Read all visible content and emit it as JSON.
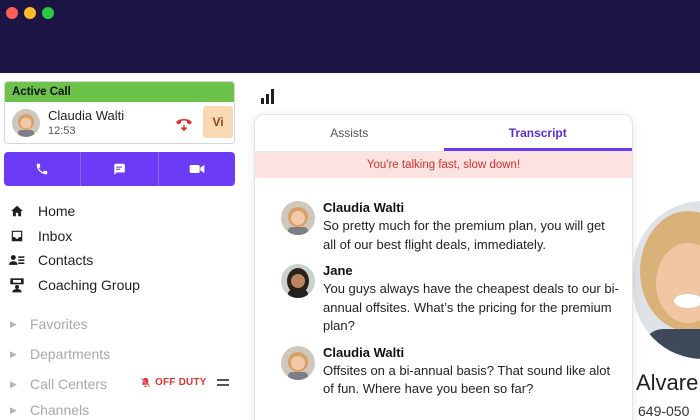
{
  "active_call": {
    "header": "Active Call",
    "caller_name": "Claudia Walti",
    "duration": "12:53",
    "vi_label": "Vi"
  },
  "nav": {
    "items": [
      {
        "label": "Home",
        "icon": "home-icon"
      },
      {
        "label": "Inbox",
        "icon": "inbox-icon"
      },
      {
        "label": "Contacts",
        "icon": "contacts-icon"
      },
      {
        "label": "Coaching Group",
        "icon": "coaching-group-icon"
      }
    ]
  },
  "sections": {
    "favorites": "Favorites",
    "departments": "Departments",
    "call_centers": "Call Centers",
    "call_centers_status": "OFF DUTY",
    "channels": "Channels"
  },
  "transcript_panel": {
    "tabs": [
      "Assists",
      "Transcript"
    ],
    "active_tab": "Transcript",
    "warning": "You're talking fast, slow down!",
    "messages": [
      {
        "speaker": "Claudia Walti",
        "text": "So pretty much for the premium plan, you will get all of our best flight deals, immediately."
      },
      {
        "speaker": "Jane",
        "text": "You guys always have the cheapest deals to our bi-annual offsites. What’s the pricing for the premium plan?"
      },
      {
        "speaker": "Claudia Walti",
        "text": "Offsites on a bi-annual basis? That sound like alot of fun. Where have you been so far?"
      }
    ]
  },
  "contact": {
    "name": "Alvare",
    "phone": "649-050"
  },
  "colors": {
    "titlebar": "#1c1442",
    "accent": "#6c3bf5",
    "active_call_green": "#6cc24a",
    "warning_bg": "#fde2e2",
    "warning_text": "#d0312d",
    "hangup_red": "#d9302c"
  }
}
